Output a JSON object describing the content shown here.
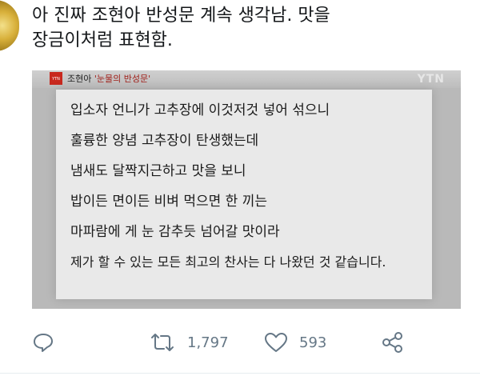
{
  "tweet": {
    "text_line1": "아 진짜 조현아 반성문 계속 생각남. 맛을",
    "text_line2": "장금이처럼 표현함."
  },
  "media": {
    "logo_text": "YTN",
    "caption_name": "조현아",
    "caption_quote": "'눈물의 반성문'",
    "watermark": "YTN",
    "lines": [
      "입소자 언니가 고추장에 이것저것 넣어 섞으니",
      "훌륭한 양념 고추장이 탄생했는데",
      "냄새도 달짝지근하고 맛을 보니",
      "밥이든 면이든 비벼 먹으면 한 끼는",
      "마파람에 게 눈 감추듯 넘어갈 맛이라",
      "제가 할 수 있는 모든 최고의 찬사는 다 나왔던 것 같습니다."
    ]
  },
  "actions": {
    "reply_icon": "speech-bubble-icon",
    "retweet_icon": "retweet-icon",
    "retweet_count": "1,797",
    "like_icon": "heart-icon",
    "like_count": "593",
    "share_icon": "share-icon"
  },
  "colors": {
    "text": "#14171a",
    "secondary": "#657786"
  }
}
